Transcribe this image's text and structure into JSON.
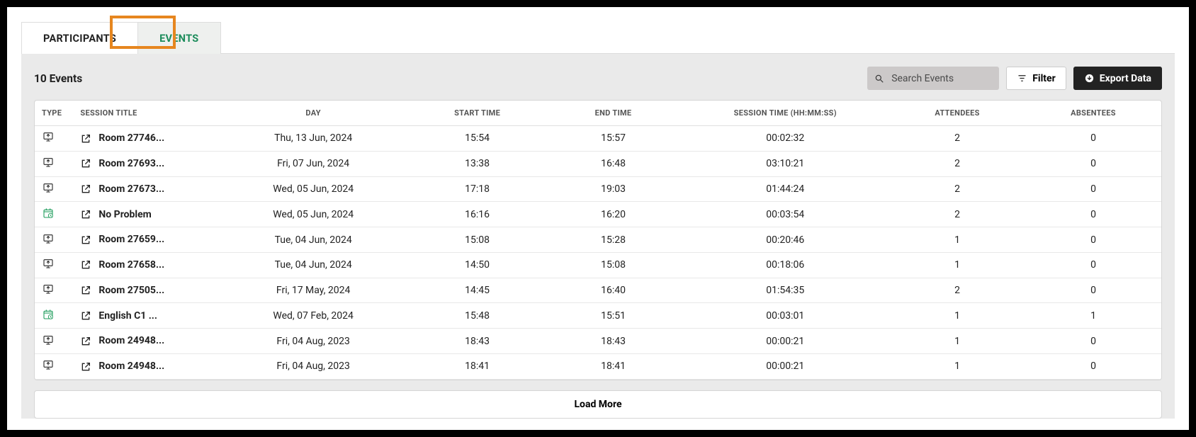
{
  "tabs": {
    "participants": "PARTICIPANTS",
    "events": "EVENTS"
  },
  "events_count": "10 Events",
  "search": {
    "placeholder": "Search Events"
  },
  "filter_label": "Filter",
  "export_label": "Export Data",
  "load_more": "Load More",
  "columns": {
    "type": "TYPE",
    "title": "SESSION TITLE",
    "day": "DAY",
    "start": "START TIME",
    "end": "END TIME",
    "session": "SESSION TIME (HH:MM:SS)",
    "attendees": "ATTENDEES",
    "absentees": "ABSENTEES"
  },
  "rows": [
    {
      "type": "screen",
      "title": "Room 27746...",
      "day": "Thu, 13 Jun, 2024",
      "start": "15:54",
      "end": "15:57",
      "session": "00:02:32",
      "attendees": "2",
      "absentees": "0"
    },
    {
      "type": "screen",
      "title": "Room 27693...",
      "day": "Fri, 07 Jun, 2024",
      "start": "13:38",
      "end": "16:48",
      "session": "03:10:21",
      "attendees": "2",
      "absentees": "0"
    },
    {
      "type": "screen",
      "title": "Room 27673...",
      "day": "Wed, 05 Jun, 2024",
      "start": "17:18",
      "end": "19:03",
      "session": "01:44:24",
      "attendees": "2",
      "absentees": "0"
    },
    {
      "type": "cal",
      "title": "No Problem",
      "day": "Wed, 05 Jun, 2024",
      "start": "16:16",
      "end": "16:20",
      "session": "00:03:54",
      "attendees": "2",
      "absentees": "0"
    },
    {
      "type": "screen",
      "title": "Room 27659...",
      "day": "Tue, 04 Jun, 2024",
      "start": "15:08",
      "end": "15:28",
      "session": "00:20:46",
      "attendees": "1",
      "absentees": "0"
    },
    {
      "type": "screen",
      "title": "Room 27658...",
      "day": "Tue, 04 Jun, 2024",
      "start": "14:50",
      "end": "15:08",
      "session": "00:18:06",
      "attendees": "1",
      "absentees": "0"
    },
    {
      "type": "screen",
      "title": "Room 27505...",
      "day": "Fri, 17 May, 2024",
      "start": "14:45",
      "end": "16:40",
      "session": "01:54:35",
      "attendees": "2",
      "absentees": "0"
    },
    {
      "type": "cal",
      "title": "English C1 ...",
      "day": "Wed, 07 Feb, 2024",
      "start": "15:48",
      "end": "15:51",
      "session": "00:03:01",
      "attendees": "1",
      "absentees": "1"
    },
    {
      "type": "screen",
      "title": "Room 24948...",
      "day": "Fri, 04 Aug, 2023",
      "start": "18:43",
      "end": "18:43",
      "session": "00:00:21",
      "attendees": "1",
      "absentees": "0"
    },
    {
      "type": "screen",
      "title": "Room 24948...",
      "day": "Fri, 04 Aug, 2023",
      "start": "18:41",
      "end": "18:41",
      "session": "00:00:21",
      "attendees": "1",
      "absentees": "0"
    }
  ]
}
